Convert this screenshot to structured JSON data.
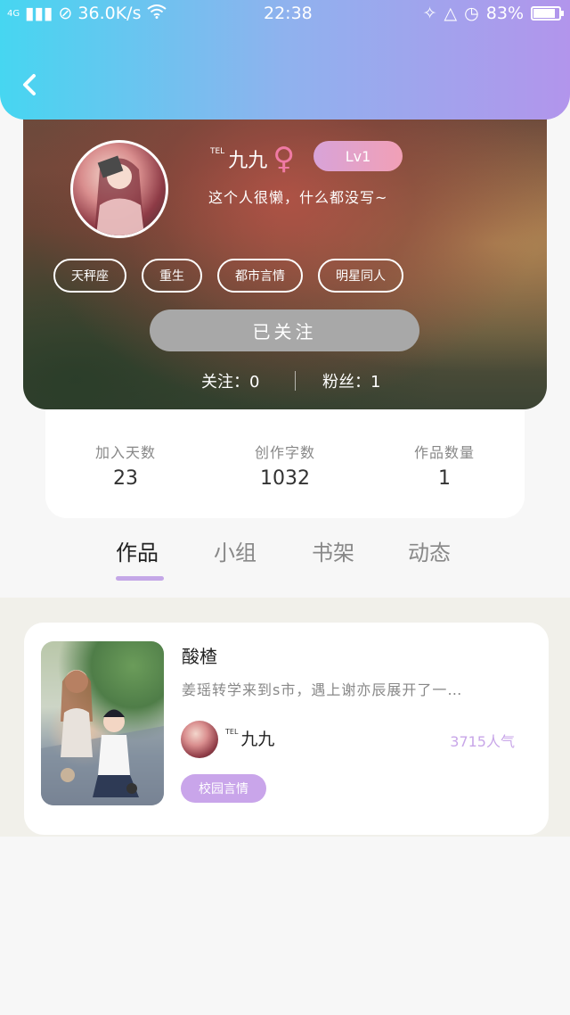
{
  "status_bar": {
    "signal": "4G",
    "speed": "36.0K/s",
    "time": "22:38",
    "battery": "83%"
  },
  "profile": {
    "tel_tag": "TEL",
    "name": "九九",
    "gender_symbol": "♀",
    "level": "Lv1",
    "signature": "这个人很懒，什么都没写~",
    "tags": [
      "天秤座",
      "重生",
      "都市言情",
      "明星同人"
    ],
    "follow_button": "已关注",
    "following_label": "关注：",
    "following_count": "0",
    "fans_label": "粉丝：",
    "fans_count": "1"
  },
  "stats": [
    {
      "label": "加入天数",
      "value": "23"
    },
    {
      "label": "创作字数",
      "value": "1032"
    },
    {
      "label": "作品数量",
      "value": "1"
    }
  ],
  "tabs": [
    "作品",
    "小组",
    "书架",
    "动态"
  ],
  "works": [
    {
      "title": "酸楂",
      "description": "姜瑶转学来到s市，遇上谢亦辰展开了一…",
      "author_tel": "TEL",
      "author_name": "九九",
      "popularity": "3715人气",
      "genre": "校园言情"
    }
  ],
  "colors": {
    "header_gradient_start": "#46d6f1",
    "header_gradient_end": "#b295ec",
    "accent_purple": "#c9a5ea",
    "female_pink": "#f07aa4"
  }
}
